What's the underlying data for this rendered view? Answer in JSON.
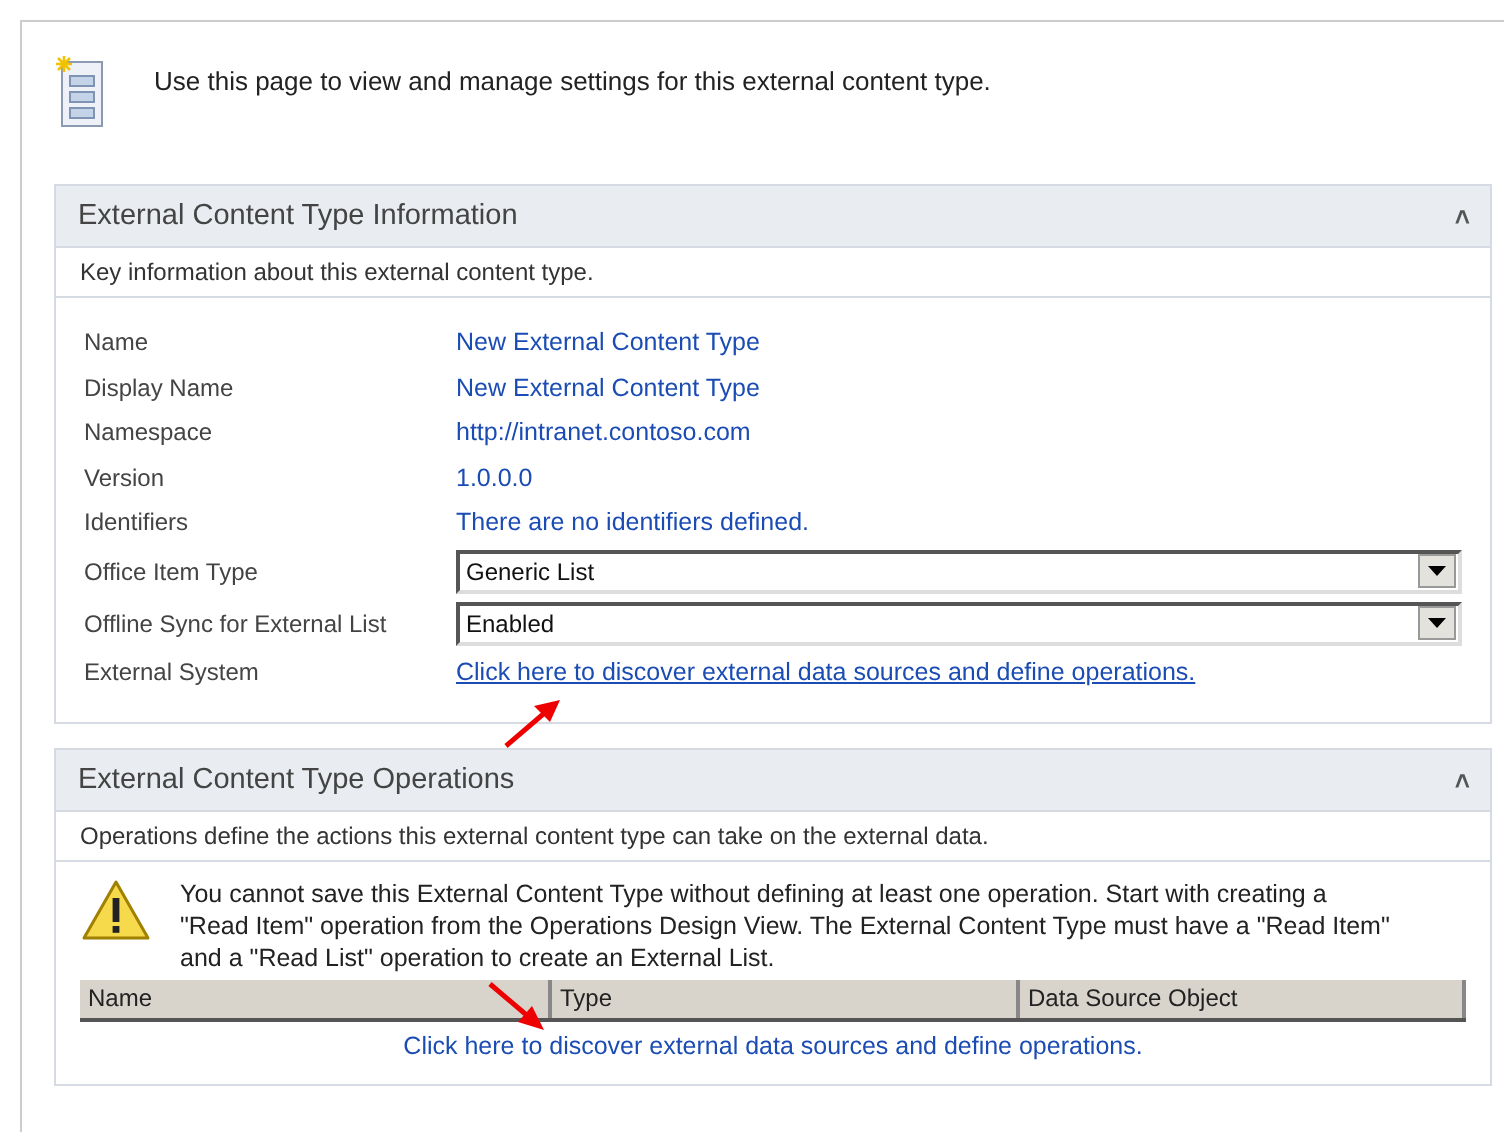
{
  "intro": {
    "text": "Use this page to view and manage settings for this external content type."
  },
  "info_panel": {
    "title": "External Content Type Information",
    "collapse_glyph": "˄",
    "description": "Key information about this external content type.",
    "fields": [
      {
        "kind": "text",
        "label": "Name",
        "value": "New External Content Type"
      },
      {
        "kind": "text",
        "label": "Display Name",
        "value": "New External Content Type"
      },
      {
        "kind": "text",
        "label": "Namespace",
        "value": "http://intranet.contoso.com"
      },
      {
        "kind": "text",
        "label": "Version",
        "value": "1.0.0.0"
      },
      {
        "kind": "text",
        "label": "Identifiers",
        "value": "There are no identifiers defined."
      },
      {
        "kind": "select",
        "label": "Office Item Type",
        "value": "Generic List"
      },
      {
        "kind": "select",
        "label": "Offline Sync for External List",
        "value": "Enabled"
      },
      {
        "kind": "link",
        "label": "External System",
        "value": "Click here to discover external data sources and define operations."
      }
    ]
  },
  "operations_panel": {
    "title": "External Content Type Operations",
    "collapse_glyph": "˄",
    "description": "Operations define the actions this external content type can take on the external data.",
    "warning": "You cannot save this External Content Type without defining at least one operation. Start with creating a \"Read Item\" operation from the Operations Design View. The External Content Type must have a \"Read Item\" and a \"Read List\" operation to create an External List.",
    "table": {
      "columns": [
        "Name",
        "Type",
        "Data Source Object"
      ]
    },
    "link": "Click here to discover external data sources and define operations."
  }
}
